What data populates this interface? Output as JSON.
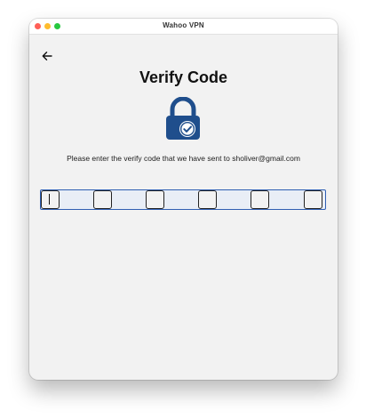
{
  "window": {
    "title": "Wahoo VPN"
  },
  "page": {
    "heading": "Verify Code",
    "instruction": "Please enter the verify code that we have sent to sholiver@gmail.com"
  },
  "code_inputs": [
    {
      "value": ""
    },
    {
      "value": ""
    },
    {
      "value": ""
    },
    {
      "value": ""
    },
    {
      "value": ""
    },
    {
      "value": ""
    }
  ],
  "colors": {
    "lock": "#1f4e8c",
    "focus_border": "#2f5fb3"
  }
}
